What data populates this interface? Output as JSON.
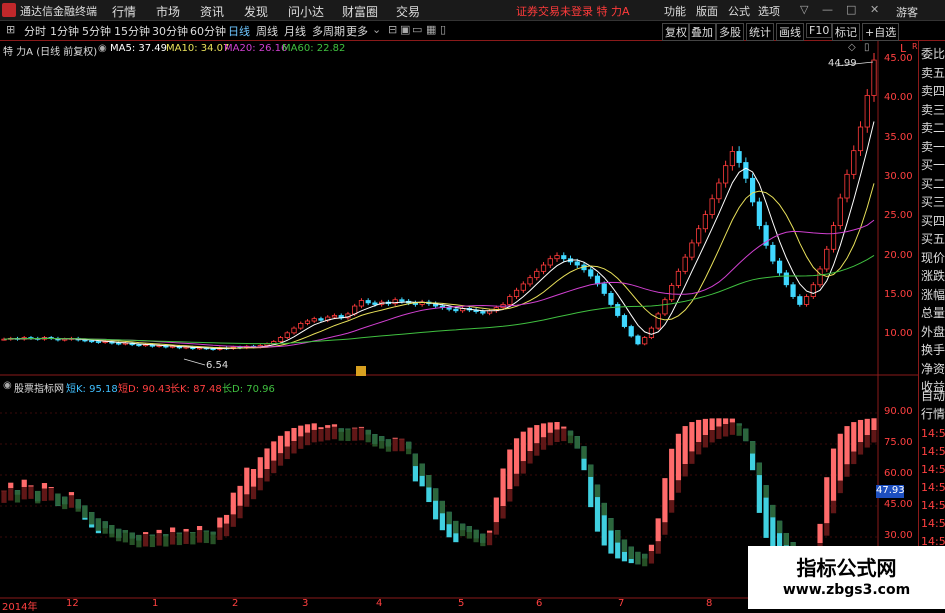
{
  "app": {
    "title": "通达信金融终端",
    "menu": [
      "行情",
      "市场",
      "资讯",
      "发现",
      "问小达",
      "财富圈",
      "交易"
    ],
    "notice": "证券交易未登录",
    "stock_title": "特 力A",
    "right_menu": [
      "功能",
      "版面",
      "公式",
      "选项"
    ],
    "guest": "游客"
  },
  "toolbar": {
    "periods": [
      "分时",
      "1分钟",
      "5分钟",
      "15分钟",
      "30分钟",
      "60分钟",
      "日线",
      "周线",
      "月线",
      "多周期",
      "更多"
    ],
    "active": "日线",
    "right_buttons": [
      "复权",
      "叠加",
      "多股",
      "统计",
      "画线",
      "F10",
      "标记",
      "+自选"
    ]
  },
  "main_chart": {
    "legend_title": "特 力A (日线 前复权)",
    "ma": [
      {
        "label": "MA5: 37.49",
        "color": "#ffffff"
      },
      {
        "label": "MA10: 34.07",
        "color": "#e8e05a"
      },
      {
        "label": "MA20: 26.16",
        "color": "#d040d0"
      },
      {
        "label": "MA60: 22.82",
        "color": "#40c040"
      }
    ],
    "y_ticks": [
      "45.00",
      "40.00",
      "35.00",
      "30.00",
      "25.00",
      "20.00",
      "15.00",
      "10.00"
    ],
    "high_label": "44.99",
    "low_label": "6.54",
    "y_scale_letter": "L",
    "y_scale_tag": "R"
  },
  "indicator": {
    "name": "股票指标网",
    "values": [
      {
        "label": "短K: 95.18",
        "color": "#40c0ff"
      },
      {
        "label": "短D: 90.43",
        "color": "#ff4040"
      },
      {
        "label": "长K: 87.48",
        "color": "#ff4040"
      },
      {
        "label": "长D: 70.96",
        "color": "#40c040"
      }
    ],
    "y_ticks": [
      "90.00",
      "75.00",
      "60.00",
      "45.00",
      "30.00"
    ],
    "current": "47.93"
  },
  "x_axis": {
    "labels": [
      "2014年",
      "12",
      "1",
      "2",
      "3",
      "4",
      "5",
      "6",
      "7",
      "8"
    ]
  },
  "right_panel": {
    "items": [
      "委比",
      "卖五",
      "卖四",
      "卖三",
      "卖二",
      "卖一",
      "买一",
      "买二",
      "买三",
      "买四",
      "买五",
      "现价",
      "涨跌",
      "涨幅",
      "总量",
      "外盘",
      "换手",
      "净资",
      "收益"
    ],
    "lower": [
      "自动",
      "行情"
    ],
    "times": [
      "14:5",
      "14:5",
      "14:5",
      "14:5",
      "14:5",
      "14:5",
      "14:5",
      "14:5",
      "14:5",
      "14:5"
    ]
  },
  "watermark": {
    "title": "指标公式网",
    "url": "www.zbgs3.com"
  },
  "chart_data": {
    "type": "candlestick",
    "ylim": [
      6,
      48
    ],
    "closes": [
      9.6,
      9.7,
      9.6,
      9.8,
      9.7,
      9.6,
      9.8,
      9.7,
      9.5,
      9.6,
      9.7,
      9.5,
      9.4,
      9.3,
      9.2,
      9.3,
      9.1,
      9.0,
      9.1,
      8.9,
      8.8,
      8.9,
      8.7,
      8.8,
      8.6,
      8.7,
      8.5,
      8.6,
      8.4,
      8.5,
      8.4,
      8.3,
      8.5,
      8.4,
      8.6,
      8.5,
      8.7,
      8.6,
      8.8,
      9.0,
      9.3,
      9.8,
      10.4,
      11.0,
      11.6,
      11.9,
      12.2,
      12.0,
      12.4,
      12.6,
      12.3,
      12.8,
      13.8,
      14.5,
      14.2,
      14.0,
      14.3,
      14.1,
      14.6,
      14.4,
      14.2,
      14.0,
      14.3,
      14.1,
      13.8,
      13.6,
      13.4,
      13.2,
      13.5,
      13.3,
      13.1,
      12.9,
      13.2,
      13.6,
      14.0,
      15.0,
      15.8,
      16.6,
      17.4,
      18.2,
      19.0,
      19.8,
      20.2,
      19.8,
      19.4,
      19.0,
      18.4,
      17.6,
      16.6,
      15.4,
      14.0,
      12.6,
      11.2,
      10.0,
      9.0,
      9.8,
      11.0,
      12.8,
      14.6,
      16.4,
      18.2,
      20.0,
      21.8,
      23.6,
      25.4,
      27.4,
      29.4,
      31.6,
      33.4,
      32.0,
      30.0,
      27.0,
      24.0,
      21.5,
      19.5,
      18.0,
      16.5,
      15.0,
      14.0,
      15.0,
      16.5,
      18.5,
      21.0,
      24.0,
      27.5,
      30.5,
      33.5,
      36.5,
      40.5,
      44.99
    ]
  }
}
